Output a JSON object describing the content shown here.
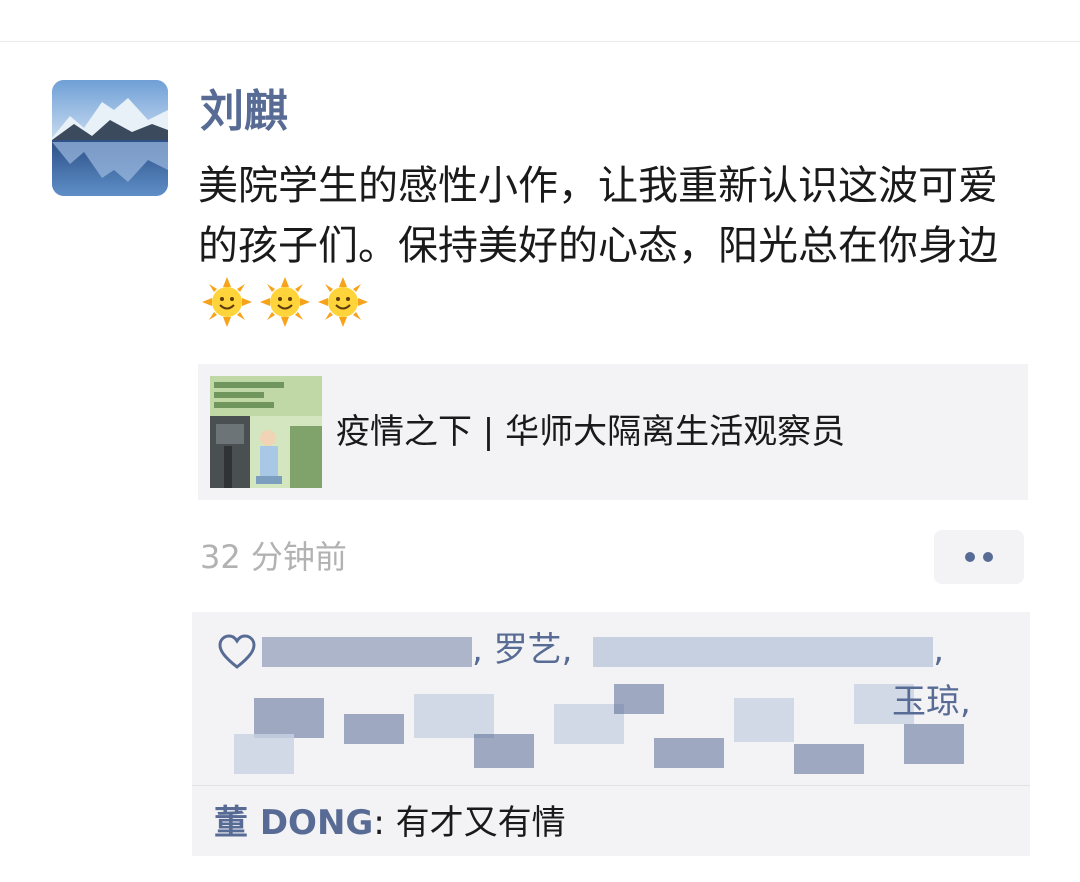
{
  "post": {
    "author": "刘麒",
    "text": "美院学生的感性小作，让我重新认识这波可爱的孩子们。保持美好的心态，阳光总在你身边",
    "emoji": [
      "sun-with-face",
      "sun-with-face",
      "sun-with-face"
    ],
    "time": "32 分钟前"
  },
  "link_card": {
    "title": "疫情之下 | 华师大隔离生活观察员"
  },
  "likes": {
    "visible_names": [
      "罗艺",
      "玉琼"
    ],
    "separator": ","
  },
  "comments": [
    {
      "author": "董 DONG",
      "separator": ": ",
      "text": "有才又有情"
    }
  ],
  "colors": {
    "name_link": "#576b95",
    "time_gray": "#b2b2b2",
    "panel_bg": "#f3f3f5"
  }
}
